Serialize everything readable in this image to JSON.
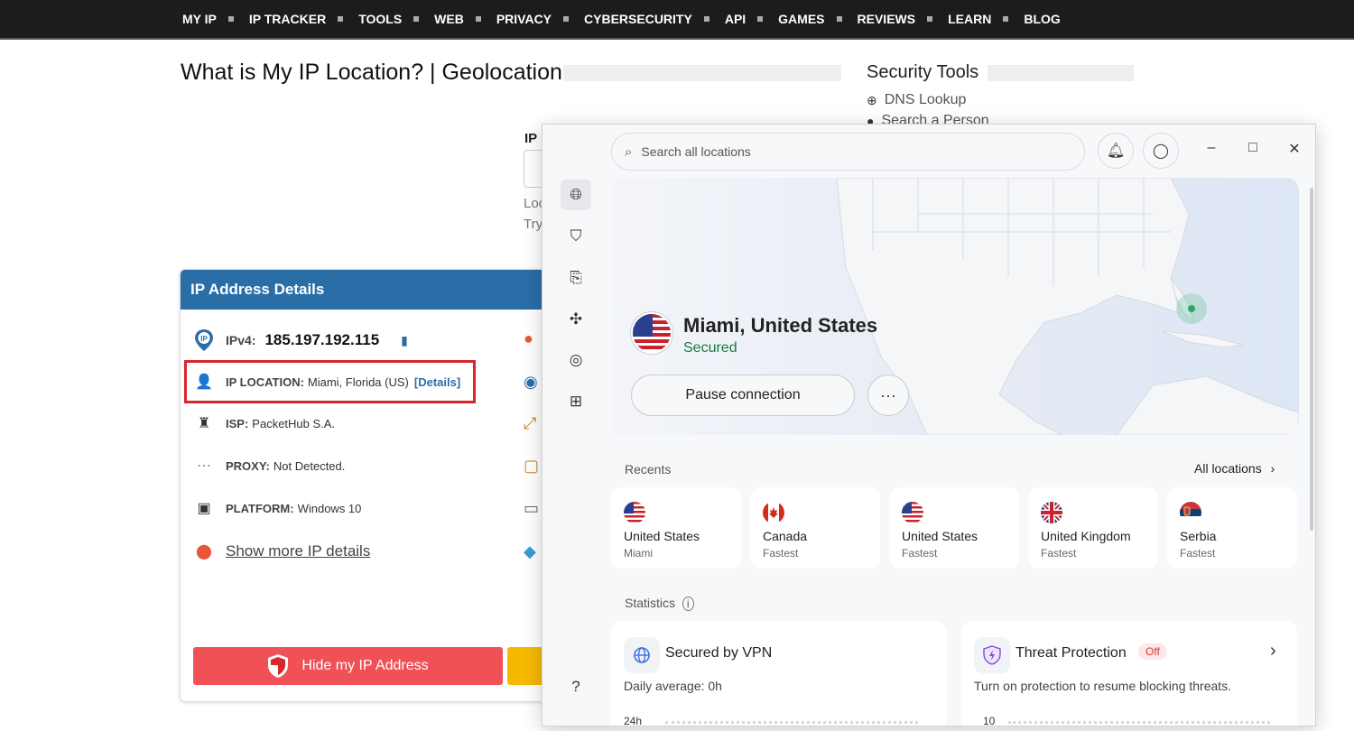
{
  "nav": [
    "MY IP",
    "IP TRACKER",
    "TOOLS",
    "WEB",
    "PRIVACY",
    "CYBERSECURITY",
    "API",
    "GAMES",
    "REVIEWS",
    "LEARN",
    "BLOG"
  ],
  "page": {
    "title": "What is My IP Location? | Geolocation",
    "faded_label": "IP",
    "faded_loc": "Loc",
    "faded_try": "Try"
  },
  "security_tools": {
    "title": "Security Tools",
    "links": [
      "DNS Lookup",
      "Search a Person"
    ]
  },
  "ip_card": {
    "header": "IP Address Details",
    "ipv4_label": "IPv4:",
    "ipv4_value": "185.197.192.115",
    "location_label": "IP LOCATION:",
    "location_value": "Miami, Florida (US)",
    "details_link": "[Details]",
    "isp_label": "ISP:",
    "isp_value": "PacketHub S.A.",
    "proxy_label": "PROXY:",
    "proxy_value": "Not Detected.",
    "platform_label": "PLATFORM:",
    "platform_value": "Windows 10",
    "show_more": "Show more IP details",
    "hide_button": "Hide my IP Address"
  },
  "vpn": {
    "search_placeholder": "Search all locations",
    "location": "Miami, United States",
    "status": "Secured",
    "pause_button": "Pause connection",
    "more_button": "···",
    "recents_label": "Recents",
    "all_locations": "All locations",
    "recents": [
      {
        "country": "United States",
        "sub": "Miami",
        "flag": "us"
      },
      {
        "country": "Canada",
        "sub": "Fastest",
        "flag": "ca"
      },
      {
        "country": "United States",
        "sub": "Fastest",
        "flag": "us"
      },
      {
        "country": "United Kingdom",
        "sub": "Fastest",
        "flag": "uk"
      },
      {
        "country": "Serbia",
        "sub": "Fastest",
        "flag": "rs"
      }
    ],
    "statistics_label": "Statistics",
    "secured_title": "Secured by VPN",
    "secured_desc": "Daily average: 0h",
    "secured_axis": "24h",
    "threat_title": "Threat Protection",
    "threat_badge": "Off",
    "threat_desc": "Turn on protection to resume blocking threats.",
    "threat_axis": "10"
  },
  "colors": {
    "nav_bg": "#1c1c1c",
    "card_header": "#2a6ea8",
    "hide_button": "#f05156",
    "secured_green": "#1e7a43",
    "highlight_red": "#d9252c"
  }
}
